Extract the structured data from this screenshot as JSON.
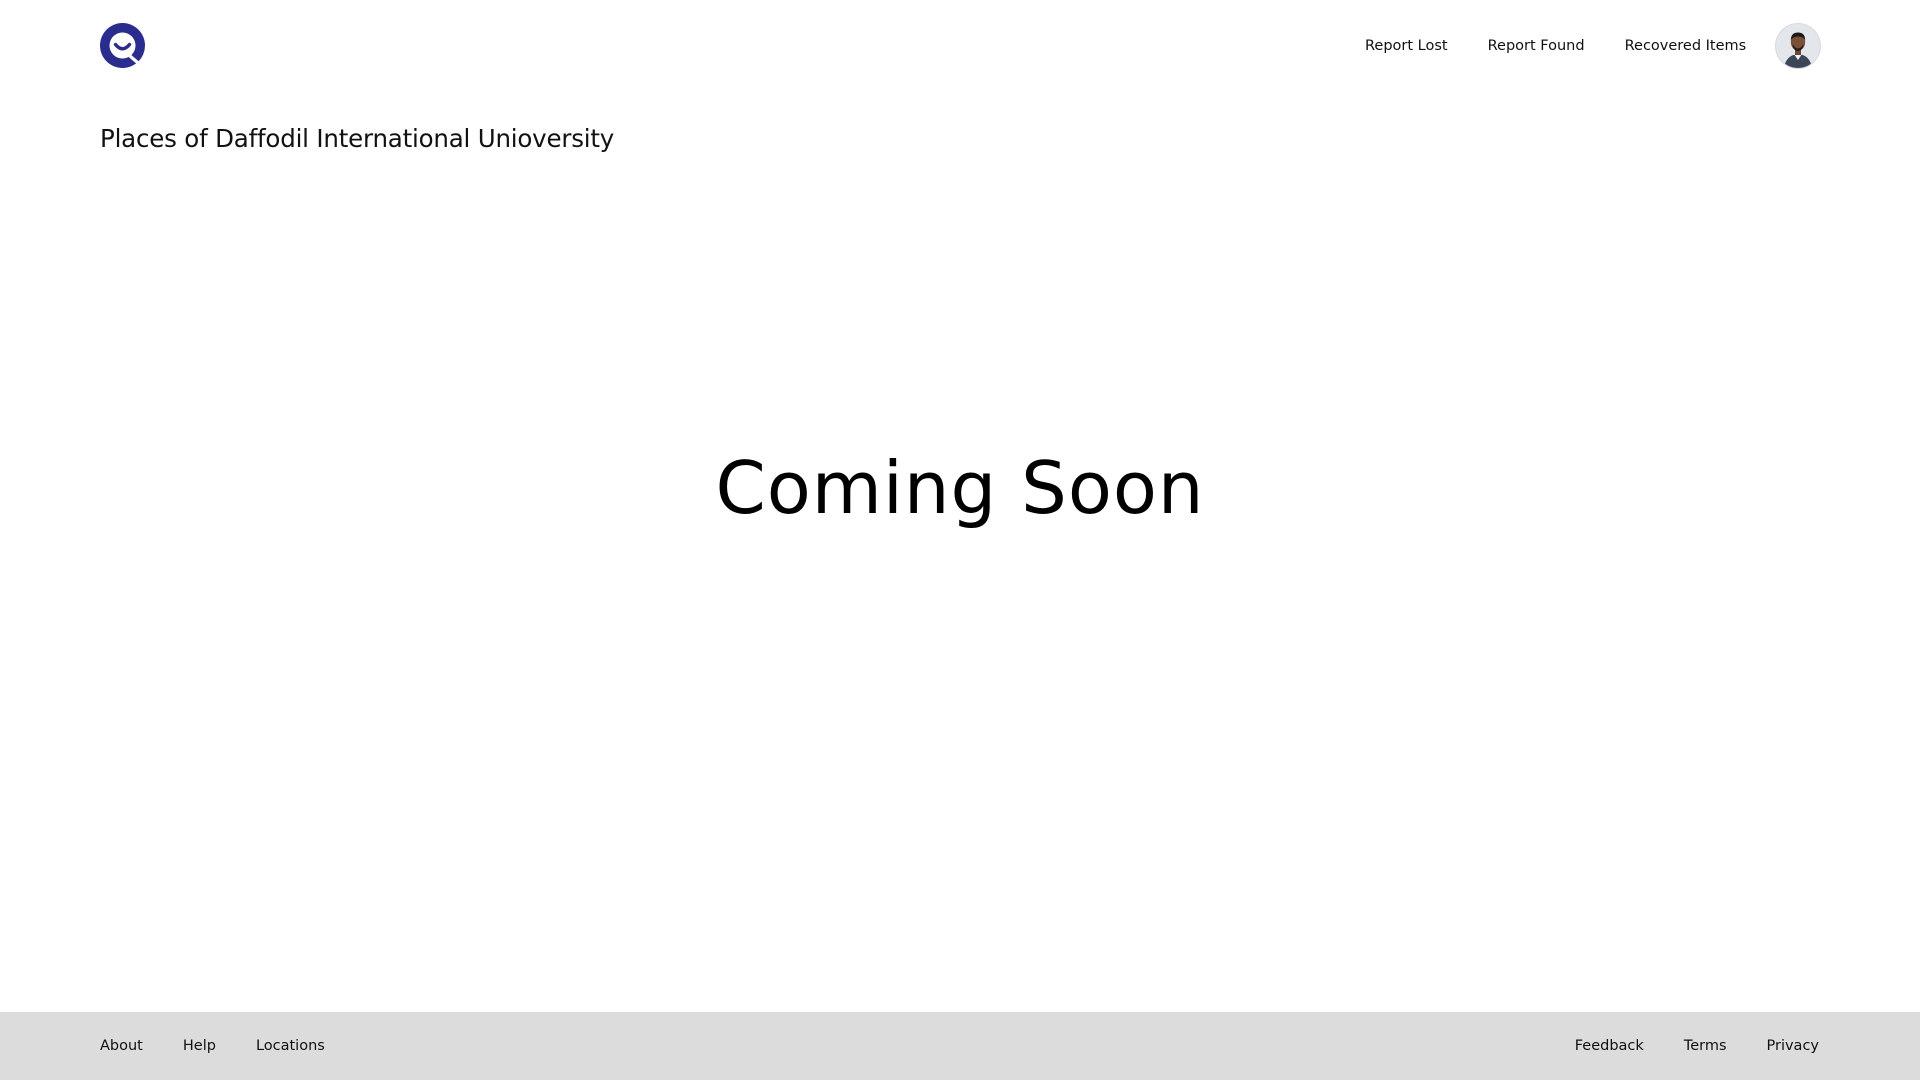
{
  "header": {
    "logo_icon": "q-smile-logo-icon",
    "nav": {
      "report_lost": "Report Lost",
      "report_found": "Report Found",
      "recovered_items": "Recovered Items"
    },
    "avatar_icon": "user-avatar-icon"
  },
  "main": {
    "page_title": "Places of Daffodil International Unioversity",
    "message": "Coming Soon"
  },
  "footer": {
    "left_links": [
      "About",
      "Help",
      "Locations"
    ],
    "right_links": [
      "Feedback",
      "Terms",
      "Privacy"
    ]
  },
  "colors": {
    "brand": "#2b2d8e",
    "footer_background": "#dcdcdc",
    "text": "#111111",
    "background": "#ffffff"
  }
}
